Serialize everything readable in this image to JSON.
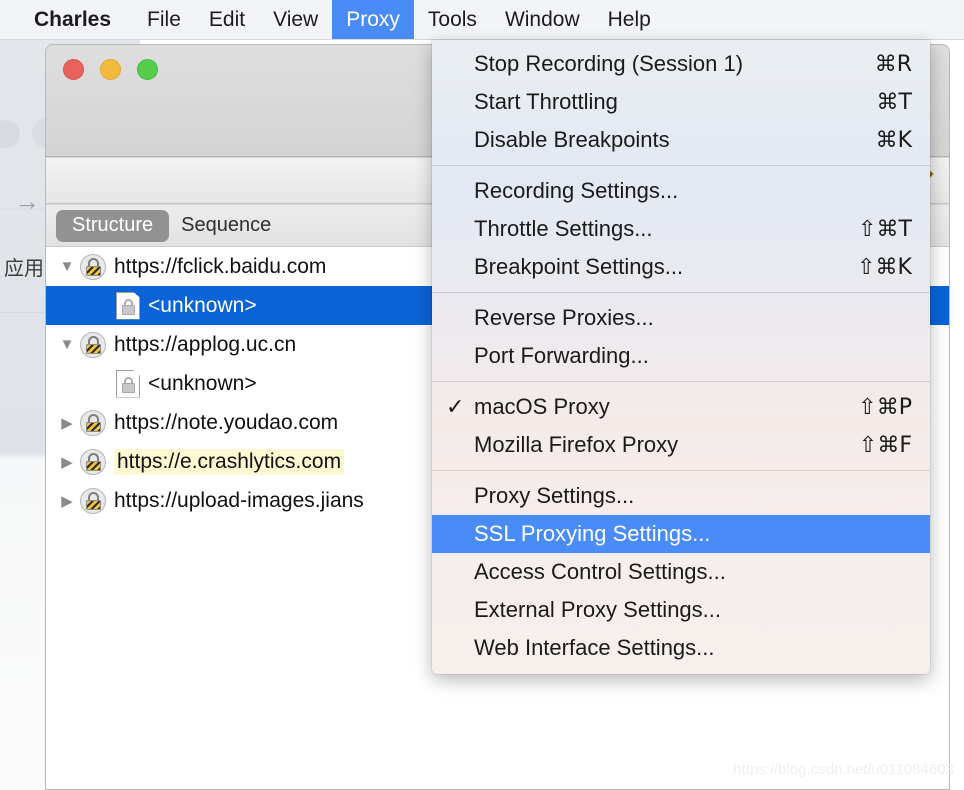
{
  "menubar": {
    "items": [
      {
        "label": "Charles",
        "active": false,
        "bold": true
      },
      {
        "label": "File",
        "active": false,
        "bold": false
      },
      {
        "label": "Edit",
        "active": false,
        "bold": false
      },
      {
        "label": "View",
        "active": false,
        "bold": false
      },
      {
        "label": "Proxy",
        "active": true,
        "bold": false
      },
      {
        "label": "Tools",
        "active": false,
        "bold": false
      },
      {
        "label": "Window",
        "active": false,
        "bold": false
      },
      {
        "label": "Help",
        "active": false,
        "bold": false
      }
    ]
  },
  "background_app": {
    "chinese_label": "应用",
    "arrow_icon": "arrow-right-icon"
  },
  "window": {
    "traffic_lights": [
      "close",
      "minimize",
      "zoom"
    ],
    "pencil_icon": "pencil-icon",
    "tabs": [
      {
        "label": "Structure",
        "selected": true
      },
      {
        "label": "Sequence",
        "selected": false
      }
    ],
    "tree": [
      {
        "label": "https://fclick.baidu.com",
        "level": 0,
        "disclosure": "open",
        "icon": "lock-round-icon",
        "selected": false,
        "highlighted": false
      },
      {
        "label": "<unknown>",
        "level": 1,
        "disclosure": "none",
        "icon": "doc-lock-icon",
        "selected": true,
        "highlighted": false
      },
      {
        "label": "https://applog.uc.cn",
        "level": 0,
        "disclosure": "open",
        "icon": "lock-round-icon",
        "selected": false,
        "highlighted": false
      },
      {
        "label": "<unknown>",
        "level": 1,
        "disclosure": "none",
        "icon": "doc-lock-icon",
        "selected": false,
        "highlighted": false
      },
      {
        "label": "https://note.youdao.com",
        "level": 0,
        "disclosure": "closed",
        "icon": "lock-round-icon",
        "selected": false,
        "highlighted": false
      },
      {
        "label": "https://e.crashlytics.com",
        "level": 0,
        "disclosure": "closed",
        "icon": "lock-round-icon",
        "selected": false,
        "highlighted": true
      },
      {
        "label": "https://upload-images.jians",
        "level": 0,
        "disclosure": "closed",
        "icon": "lock-round-icon",
        "selected": false,
        "highlighted": false
      }
    ]
  },
  "proxy_menu": {
    "groups": [
      {
        "items": [
          {
            "label": "Stop Recording (Session 1)",
            "shortcut": "⌘R",
            "checked": false,
            "selected": false
          },
          {
            "label": "Start Throttling",
            "shortcut": "⌘T",
            "checked": false,
            "selected": false
          },
          {
            "label": "Disable Breakpoints",
            "shortcut": "⌘K",
            "checked": false,
            "selected": false
          }
        ]
      },
      {
        "items": [
          {
            "label": "Recording Settings...",
            "shortcut": "",
            "checked": false,
            "selected": false
          },
          {
            "label": "Throttle Settings...",
            "shortcut": "⇧⌘T",
            "checked": false,
            "selected": false
          },
          {
            "label": "Breakpoint Settings...",
            "shortcut": "⇧⌘K",
            "checked": false,
            "selected": false
          }
        ]
      },
      {
        "items": [
          {
            "label": "Reverse Proxies...",
            "shortcut": "",
            "checked": false,
            "selected": false
          },
          {
            "label": "Port Forwarding...",
            "shortcut": "",
            "checked": false,
            "selected": false
          }
        ]
      },
      {
        "items": [
          {
            "label": "macOS Proxy",
            "shortcut": "⇧⌘P",
            "checked": true,
            "selected": false
          },
          {
            "label": "Mozilla Firefox Proxy",
            "shortcut": "⇧⌘F",
            "checked": false,
            "selected": false
          }
        ]
      },
      {
        "items": [
          {
            "label": "Proxy Settings...",
            "shortcut": "",
            "checked": false,
            "selected": false
          },
          {
            "label": "SSL Proxying Settings...",
            "shortcut": "",
            "checked": false,
            "selected": true
          },
          {
            "label": "Access Control Settings...",
            "shortcut": "",
            "checked": false,
            "selected": false
          },
          {
            "label": "External Proxy Settings...",
            "shortcut": "",
            "checked": false,
            "selected": false
          },
          {
            "label": "Web Interface Settings...",
            "shortcut": "",
            "checked": false,
            "selected": false
          }
        ]
      }
    ]
  },
  "watermark": {
    "text": "https://blog.csdn.net/u011084603"
  },
  "colors": {
    "accent_blue": "#4a8cf7",
    "selection_blue": "#0a64d8",
    "highlight_yellow": "#fbf8d2",
    "menubar_bg": "#f2f4f7"
  }
}
